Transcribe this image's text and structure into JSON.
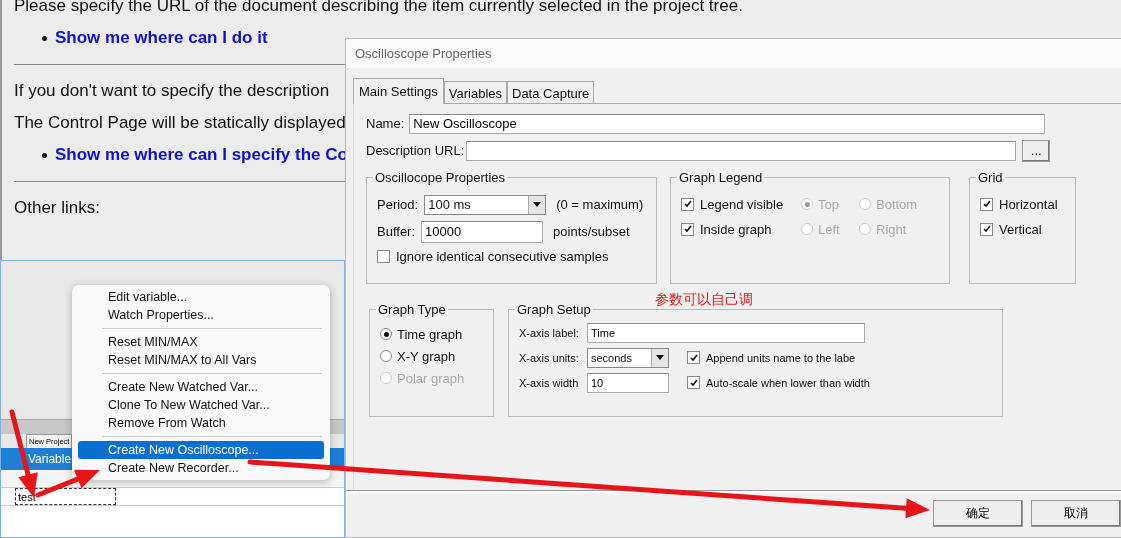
{
  "help_page": {
    "blocks": [
      {
        "kind": "text",
        "text": "Please specify the URL of the document describing the item currently selected in the project tree."
      },
      {
        "kind": "link",
        "text": "Show me where can I do it"
      },
      {
        "kind": "rule"
      },
      {
        "kind": "text",
        "text": "If you don't want to specify the description"
      },
      {
        "kind": "text",
        "text": "The Control Page will be statically displayed"
      },
      {
        "kind": "link",
        "text": "Show me where can I specify the Co"
      },
      {
        "kind": "rule"
      },
      {
        "kind": "text",
        "text": "Other links:"
      }
    ]
  },
  "watch_window": {
    "tab": "New Project",
    "title": "Variable",
    "rows": [
      {
        "name": "test",
        "selected": true
      }
    ]
  },
  "context_menu": {
    "groups": [
      [
        {
          "label": "Edit variable...",
          "selected": false
        },
        {
          "label": "Watch Properties...",
          "selected": false
        }
      ],
      [
        {
          "label": "Reset MIN/MAX",
          "selected": false
        },
        {
          "label": "Reset MIN/MAX to All Vars",
          "selected": false
        }
      ],
      [
        {
          "label": "Create New Watched Var...",
          "selected": false
        },
        {
          "label": "Clone To New Watched Var...",
          "selected": false
        },
        {
          "label": "Remove From Watch",
          "selected": false
        }
      ],
      [
        {
          "label": "Create New Oscilloscope...",
          "selected": true
        },
        {
          "label": "Create New Recorder...",
          "selected": false
        }
      ]
    ]
  },
  "dialog": {
    "title": "Oscilloscope Properties",
    "tabs": [
      {
        "label": "Main Settings",
        "selected": true
      },
      {
        "label": "Variables",
        "selected": false
      },
      {
        "label": "Data Capture",
        "selected": false
      }
    ],
    "name": {
      "label": "Name:",
      "value": "New Oscilloscope"
    },
    "description_url": {
      "label": "Description URL:",
      "button": "..."
    },
    "osc_properties": {
      "title": "Oscillocope Properties",
      "period": {
        "label": "Period:",
        "value": "100 ms",
        "note": "(0 = maximum)"
      },
      "buffer": {
        "label": "Buffer:",
        "value": "10000",
        "note": "points/subset"
      },
      "ignore": {
        "label": "Ignore identical consecutive samples",
        "checked": false
      }
    },
    "graph_legend": {
      "title": "Graph Legend",
      "checks": [
        {
          "label": "Legend visible",
          "checked": true
        },
        {
          "label": "Inside graph",
          "checked": true
        }
      ],
      "positions": [
        {
          "label": "Top",
          "selected": true,
          "disabled": true
        },
        {
          "label": "Bottom",
          "selected": false,
          "disabled": true
        },
        {
          "label": "Left",
          "selected": false,
          "disabled": true
        },
        {
          "label": "Right",
          "selected": false,
          "disabled": true
        }
      ]
    },
    "grid": {
      "title": "Grid",
      "checks": [
        {
          "label": "Horizontal",
          "checked": true
        },
        {
          "label": "Vertical",
          "checked": true
        }
      ]
    },
    "graph_type": {
      "title": "Graph Type",
      "options": [
        {
          "label": "Time graph",
          "selected": true,
          "disabled": false
        },
        {
          "label": "X-Y graph",
          "selected": false,
          "disabled": false
        },
        {
          "label": "Polar graph",
          "selected": false,
          "disabled": true
        }
      ]
    },
    "graph_setup": {
      "title": "Graph Setup",
      "x_label": {
        "label": "X-axis label:",
        "value": "Time"
      },
      "x_units": {
        "label": "X-axis units:",
        "value": "seconds",
        "check": {
          "label": "Append units name to the labe",
          "checked": true
        }
      },
      "x_width": {
        "label": "X-axis width",
        "value": "10",
        "check": {
          "label": "Auto-scale when lower than width",
          "checked": true
        }
      }
    },
    "buttons": [
      "确定",
      "取消"
    ]
  },
  "annotation": {
    "text": "参数可以自己调"
  }
}
